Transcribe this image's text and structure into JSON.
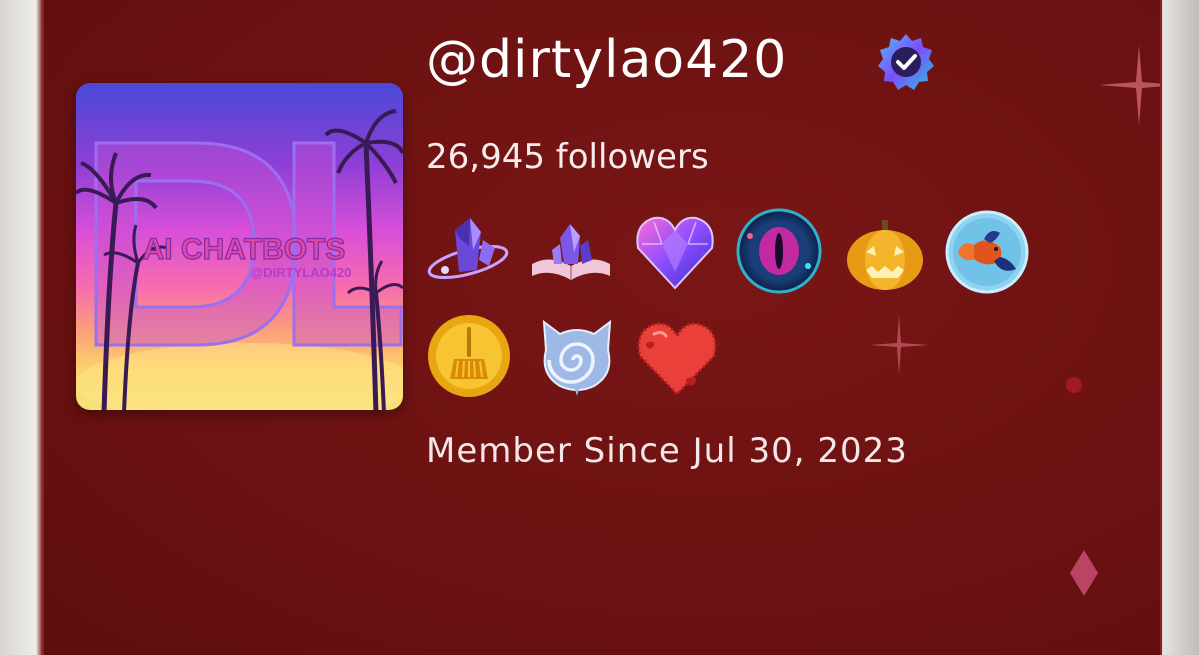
{
  "profile": {
    "handle": "@dirtylao420",
    "verified_icon": "verified-badge-icon",
    "followers_text": "26,945 followers",
    "member_since_text": "Member Since Jul 30, 2023"
  },
  "avatar": {
    "initials": "DL",
    "title": "AI CHATBOTS",
    "subtitle": "@DIRTYLAO420"
  },
  "badges": [
    {
      "name": "crystal-orbit-badge-icon"
    },
    {
      "name": "crystal-book-badge-icon"
    },
    {
      "name": "gem-heart-badge-icon"
    },
    {
      "name": "dragon-eye-badge-icon"
    },
    {
      "name": "pumpkin-badge-icon"
    },
    {
      "name": "betta-fish-badge-icon"
    },
    {
      "name": "broom-coin-badge-icon"
    },
    {
      "name": "spiral-cat-badge-icon"
    },
    {
      "name": "red-heart-badge-icon"
    }
  ],
  "colors": {
    "background": "#6e1212",
    "text": "#ffffff"
  }
}
